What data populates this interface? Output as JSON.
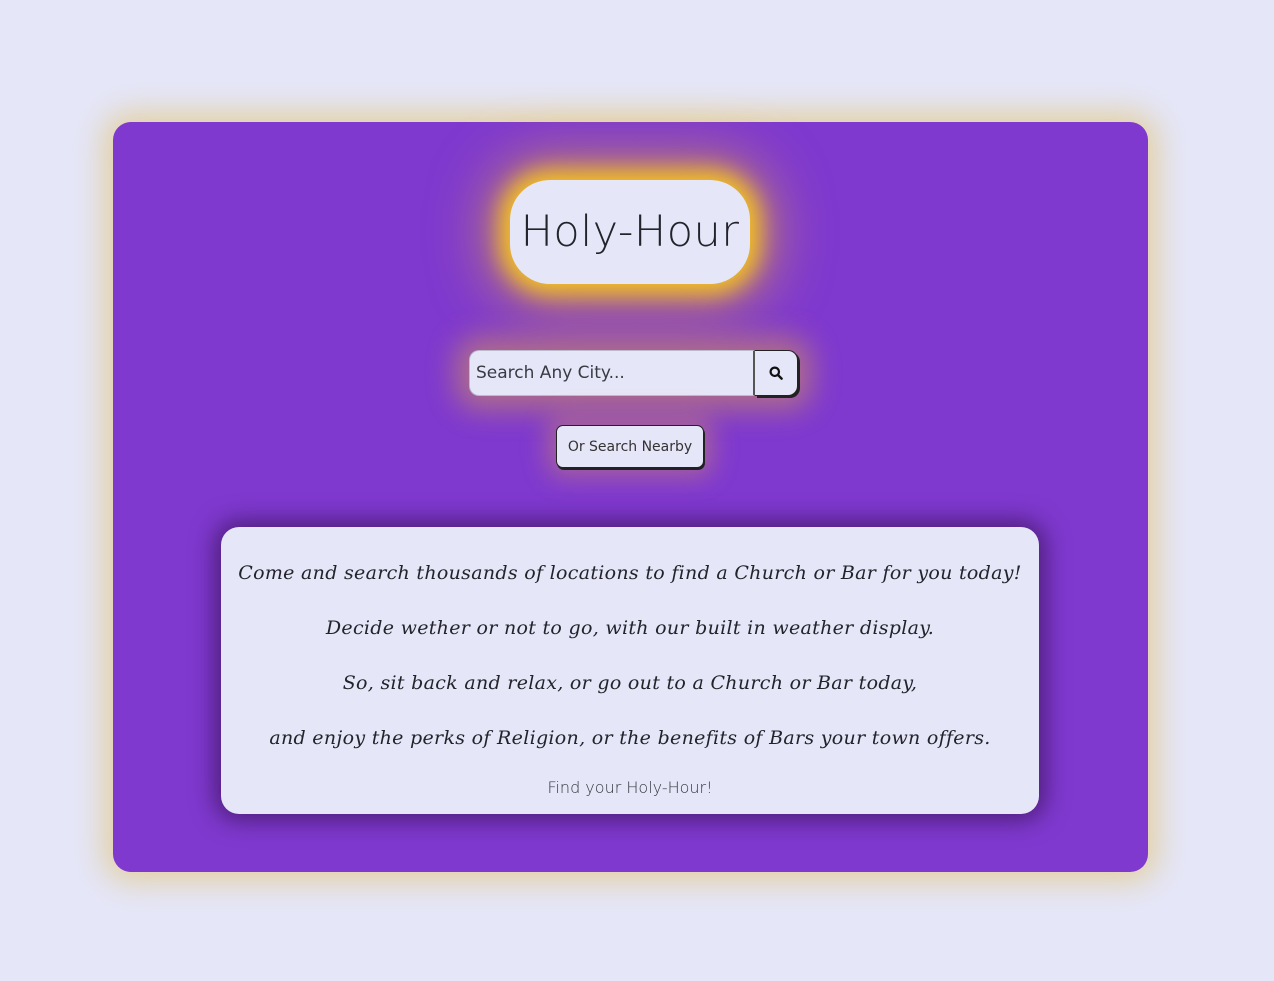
{
  "app": {
    "title": "Holy-Hour"
  },
  "search": {
    "placeholder": "Search Any City...",
    "button_icon": "search-icon",
    "nearby_label": "Or Search Nearby"
  },
  "info": {
    "lines": [
      "Come and search thousands of locations to find a Church or Bar for you today!",
      "Decide wether or not to go, with our built in weather display.",
      "So, sit back and relax, or go out to a Church or Bar today,",
      "and enjoy the perks of Religion, or the benefits of Bars your town offers."
    ],
    "tagline": "Find your Holy-Hour!"
  },
  "colors": {
    "page_background": "#e5e6f8",
    "card_background": "#7f39cf",
    "title_glow": "#f6c420",
    "panel_background": "#e5e6f8",
    "text": "#22232b"
  }
}
